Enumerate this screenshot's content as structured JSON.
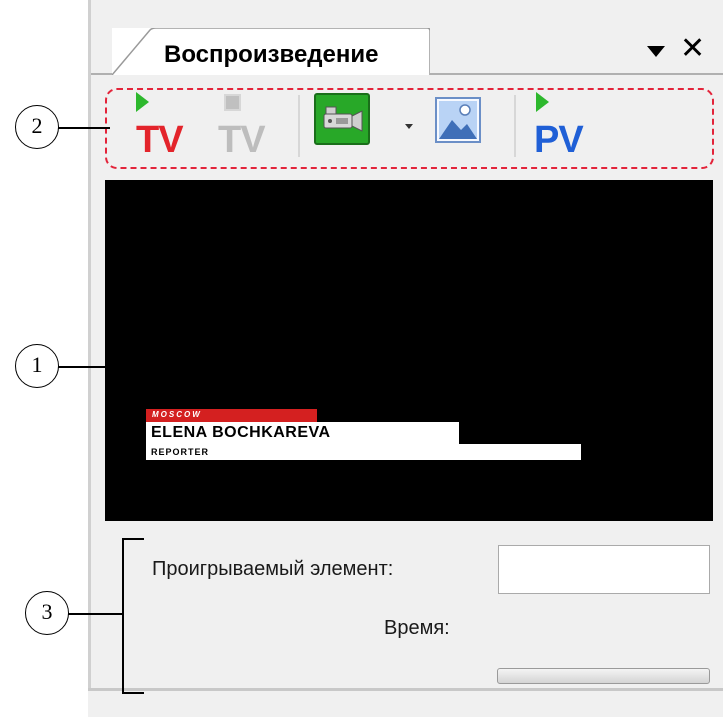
{
  "panel": {
    "tab_title": "Воспроизведение",
    "controls": {
      "dropdown_icon": "triangle-down",
      "close_label": "✕"
    }
  },
  "toolbar": {
    "play_tv": {
      "label": "TV",
      "color": "#e3242b",
      "icon": "play-triangle"
    },
    "stop_tv": {
      "label": "TV",
      "color": "#bdbdbd",
      "icon": "stop-square"
    },
    "camera": {
      "icon": "video-camera-icon",
      "color": "#28a828"
    },
    "image": {
      "icon": "picture-icon"
    },
    "play_pv": {
      "label": "PV",
      "color": "#1f5fd6",
      "icon": "play-triangle"
    }
  },
  "preview": {
    "lower_third": {
      "location": "MOSCOW",
      "name": "ELENA BOCHKAREVA",
      "role": "REPORTER"
    }
  },
  "info": {
    "playing_label": "Проигрываемый элемент:",
    "playing_value": "",
    "time_label": "Время:"
  },
  "callouts": [
    "1",
    "2",
    "3"
  ]
}
